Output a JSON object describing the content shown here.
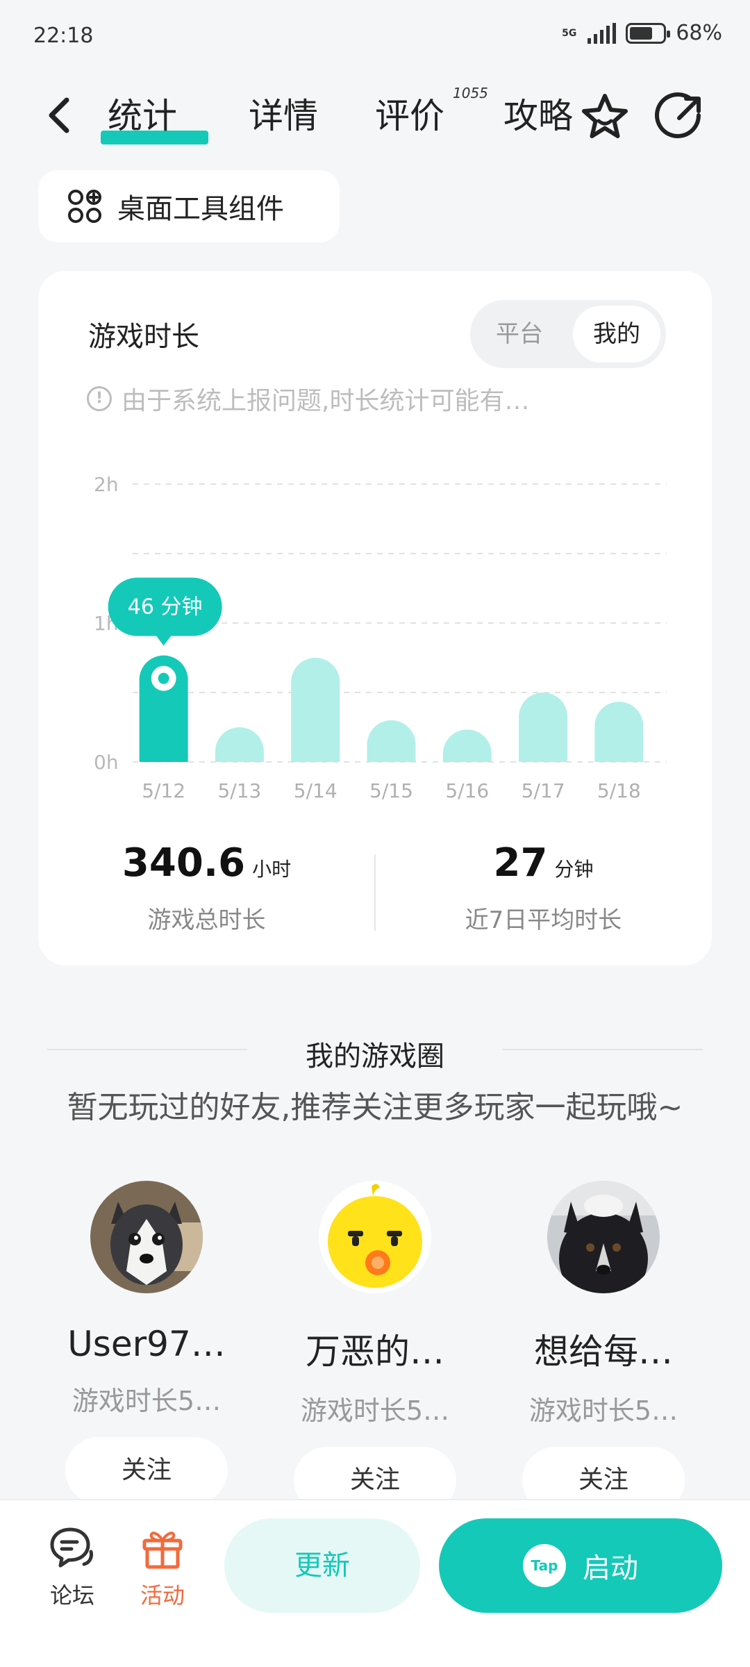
{
  "status_bar": {
    "time": "22:18",
    "network": "5G",
    "battery": "68%",
    "battery_level": 0.68
  },
  "nav": {
    "tabs": [
      "统计",
      "详情",
      "评价",
      "攻略"
    ],
    "review_count": "1055"
  },
  "widget": {
    "label": "桌面工具组件"
  },
  "stats_card": {
    "title": "游戏时长",
    "segment": {
      "options": [
        "平台",
        "我的"
      ],
      "selected": "我的"
    },
    "notice": "由于系统上报问题,时长统计可能有…",
    "tooltip": "46 分钟",
    "total": {
      "value": "340.6",
      "unit": "小时",
      "label": "游戏总时长"
    },
    "average": {
      "value": "27",
      "unit": "分钟",
      "label": "近7日平均时长"
    }
  },
  "chart_data": {
    "type": "bar",
    "categories": [
      "5/12",
      "5/13",
      "5/14",
      "5/15",
      "5/16",
      "5/17",
      "5/18"
    ],
    "values": [
      46,
      15,
      45,
      18,
      14,
      30,
      26
    ],
    "unit": "minutes",
    "yticks": [
      "0h",
      "1h",
      "2h"
    ],
    "ylim": [
      0,
      120
    ],
    "highlight_index": 0,
    "grid": true,
    "colors": {
      "highlight": "#14c9b8",
      "bar": "#b2efe9"
    }
  },
  "game_circle": {
    "title": "我的游戏圈",
    "recommend": "暂无玩过的好友,推荐关注更多玩家一起玩哦~",
    "friends": [
      {
        "name": "User97…",
        "subtitle": "游戏时长5…",
        "follow": "关注",
        "avatar": "husky"
      },
      {
        "name": "万恶的…",
        "subtitle": "游戏时长5…",
        "follow": "关注",
        "avatar": "yellow-duck"
      },
      {
        "name": "想给每…",
        "subtitle": "游戏时长5…",
        "follow": "关注",
        "avatar": "black-dog"
      }
    ]
  },
  "bottom_bar": {
    "forum": "论坛",
    "activity": "活动",
    "update": "更新",
    "launch": "启动",
    "launch_logo": "Tap",
    "colors": {
      "accent": "#14c9b8",
      "activity": "#f26a3c"
    }
  }
}
